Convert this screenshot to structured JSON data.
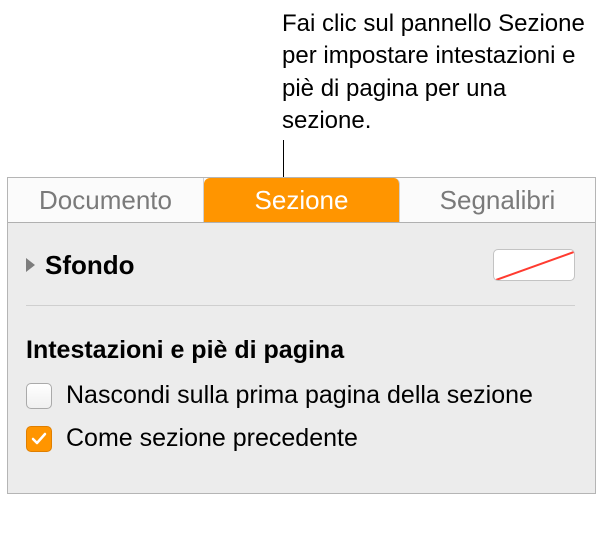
{
  "callout": {
    "text": "Fai clic sul pannello Sezione per impostare intestazioni e piè di pagina per una sezione."
  },
  "tabs": {
    "document": "Documento",
    "section": "Sezione",
    "bookmarks": "Segnalibri"
  },
  "background": {
    "label": "Sfondo"
  },
  "headers_footers": {
    "title": "Intestazioni e piè di pagina",
    "hide_first": "Nascondi sulla prima pagina della sezione",
    "match_previous": "Come sezione precedente"
  }
}
